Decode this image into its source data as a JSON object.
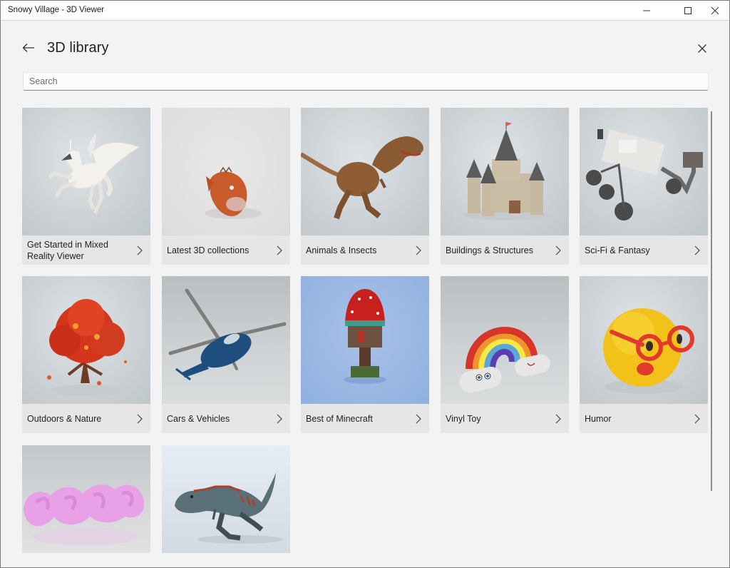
{
  "window": {
    "title": "Snowy Village - 3D Viewer",
    "controls": [
      "minimize",
      "maximize",
      "close"
    ]
  },
  "header": {
    "back_icon": "arrow-left-icon",
    "title": "3D library",
    "close_icon": "close-icon"
  },
  "search": {
    "placeholder": "Search",
    "value": ""
  },
  "categories": [
    {
      "label": "Get Started in Mixed Reality Viewer",
      "thumbnail": "pegasus"
    },
    {
      "label": "Latest 3D collections",
      "thumbnail": "anglerfish"
    },
    {
      "label": "Animals & Insects",
      "thumbnail": "t-rex"
    },
    {
      "label": "Buildings & Structures",
      "thumbnail": "castle"
    },
    {
      "label": "Sci-Fi & Fantasy",
      "thumbnail": "mars-rover"
    },
    {
      "label": "Outdoors & Nature",
      "thumbnail": "red-tree"
    },
    {
      "label": "Cars & Vehicles",
      "thumbnail": "helicopter"
    },
    {
      "label": "Best of Minecraft",
      "thumbnail": "minecraft-mushroom-house"
    },
    {
      "label": "Vinyl Toy",
      "thumbnail": "rainbow"
    },
    {
      "label": "Humor",
      "thumbnail": "emoji-glasses"
    },
    {
      "label": "",
      "thumbnail": "pink-squish-text"
    },
    {
      "label": "",
      "thumbnail": "running-dinosaur"
    }
  ],
  "icons": {
    "chevron": "chevron-right-icon"
  }
}
